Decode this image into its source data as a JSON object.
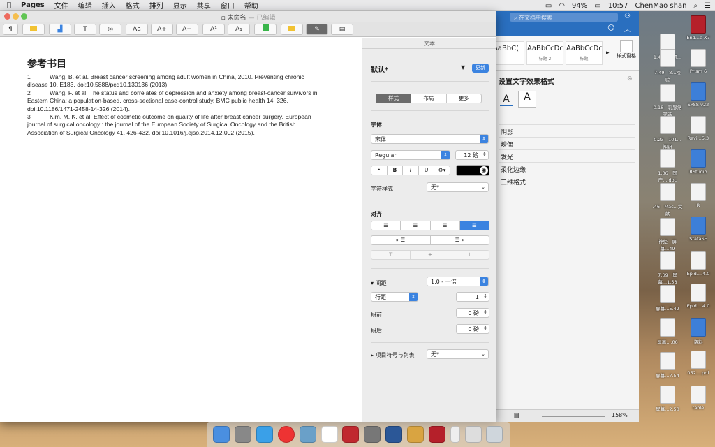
{
  "menubar": {
    "apple": "",
    "app": "Pages",
    "items": [
      "文件",
      "编辑",
      "插入",
      "格式",
      "排列",
      "显示",
      "共享",
      "窗口",
      "帮助"
    ],
    "battery": "94%",
    "time": "10:57",
    "user": "ChenMao shan"
  },
  "desktop": {
    "icons": [
      {
        "label": "1.45　科研...总结"
      },
      {
        "label": "End...e X7"
      },
      {
        "label": "7.49　8...检验"
      },
      {
        "label": "Prism 6"
      },
      {
        "label": "0.18　乳腺癌筛选"
      },
      {
        "label": "SPSS v22"
      },
      {
        "label": "0.23　101...知识"
      },
      {
        "label": "Revi...5.3"
      },
      {
        "label": "1.06　国产....doc"
      },
      {
        "label": "RStudio"
      },
      {
        "label": ".46　Mac...文献"
      },
      {
        "label": "R"
      },
      {
        "label": "神经　屏幕...49"
      },
      {
        "label": "StataSE"
      },
      {
        "label": "7.09　屏幕...1.53"
      },
      {
        "label": "Epid....4.0"
      },
      {
        "label": "屏幕...5.42"
      },
      {
        "label": "Epid....4.0"
      },
      {
        "label": "屏幕....00"
      },
      {
        "label": "资料"
      },
      {
        "label": "屏幕...7.54"
      },
      {
        "label": "052....pdf"
      },
      {
        "label": "屏幕...2.58"
      },
      {
        "label": "table"
      }
    ]
  },
  "word": {
    "search_placeholder": "在文档中搜索",
    "styles": [
      {
        "preview": "AaBbC(",
        "name": ""
      },
      {
        "preview": "AaBbCcDc",
        "name": "标题 2"
      },
      {
        "preview": "AaBbCcDc",
        "name": "标题"
      }
    ],
    "styles_pane": "样式窗格",
    "panel_title": "设置文字效果格式",
    "effects": [
      "阴影",
      "映像",
      "发光",
      "柔化边缘",
      "三维格式"
    ],
    "zoom": "158%"
  },
  "pages": {
    "title": "未命名",
    "subtitle": "— 已编辑",
    "toolbar_buttons": [
      "¶",
      "",
      "",
      "T",
      "",
      "Aa",
      "A+",
      "A−",
      "A¹",
      "A₁",
      "",
      "",
      "",
      ""
    ],
    "doc": {
      "heading": "参考书目",
      "refs": [
        {
          "num": "1",
          "text": "Wang, B. et al. Breast cancer screening among adult women in China, 2010. Preventing chronic disease 10, E183, doi:10.5888/pcd10.130136 (2013)."
        },
        {
          "num": "2",
          "text": "Wang, F. et al. The status and correlates of depression and anxiety among breast-cancer survivors in Eastern China: a population-based, cross-sectional case-control study. BMC public health 14, 326, doi:10.1186/1471-2458-14-326 (2014)."
        },
        {
          "num": "3",
          "text": "Kim, M. K. et al. Effect of cosmetic outcome on quality of life after breast cancer surgery. European journal of surgical oncology : the journal of the European Society of Surgical Oncology and the British Association of Surgical Oncology 41, 426-432, doi:10.1016/j.ejso.2014.12.002 (2015)."
        }
      ]
    },
    "inspector": {
      "header": "文本",
      "style_name": "默认*",
      "update": "更新",
      "tabs": [
        "样式",
        "布局",
        "更多"
      ],
      "font_label": "字体",
      "font": "宋体",
      "weight": "Regular",
      "size": "12 磅",
      "format_buttons": [
        "•",
        "B",
        "I",
        "U",
        "⚙▾"
      ],
      "char_style_label": "字符样式",
      "char_style": "无*",
      "align_label": "对齐",
      "spacing_label": "间距",
      "spacing": "1.0 - 一倍",
      "line_label": "行距",
      "line_value": "1",
      "before_label": "段前",
      "before_value": "0 磅",
      "after_label": "段后",
      "after_value": "0 磅",
      "list_label": "项目符号与列表",
      "list_value": "无*"
    }
  }
}
